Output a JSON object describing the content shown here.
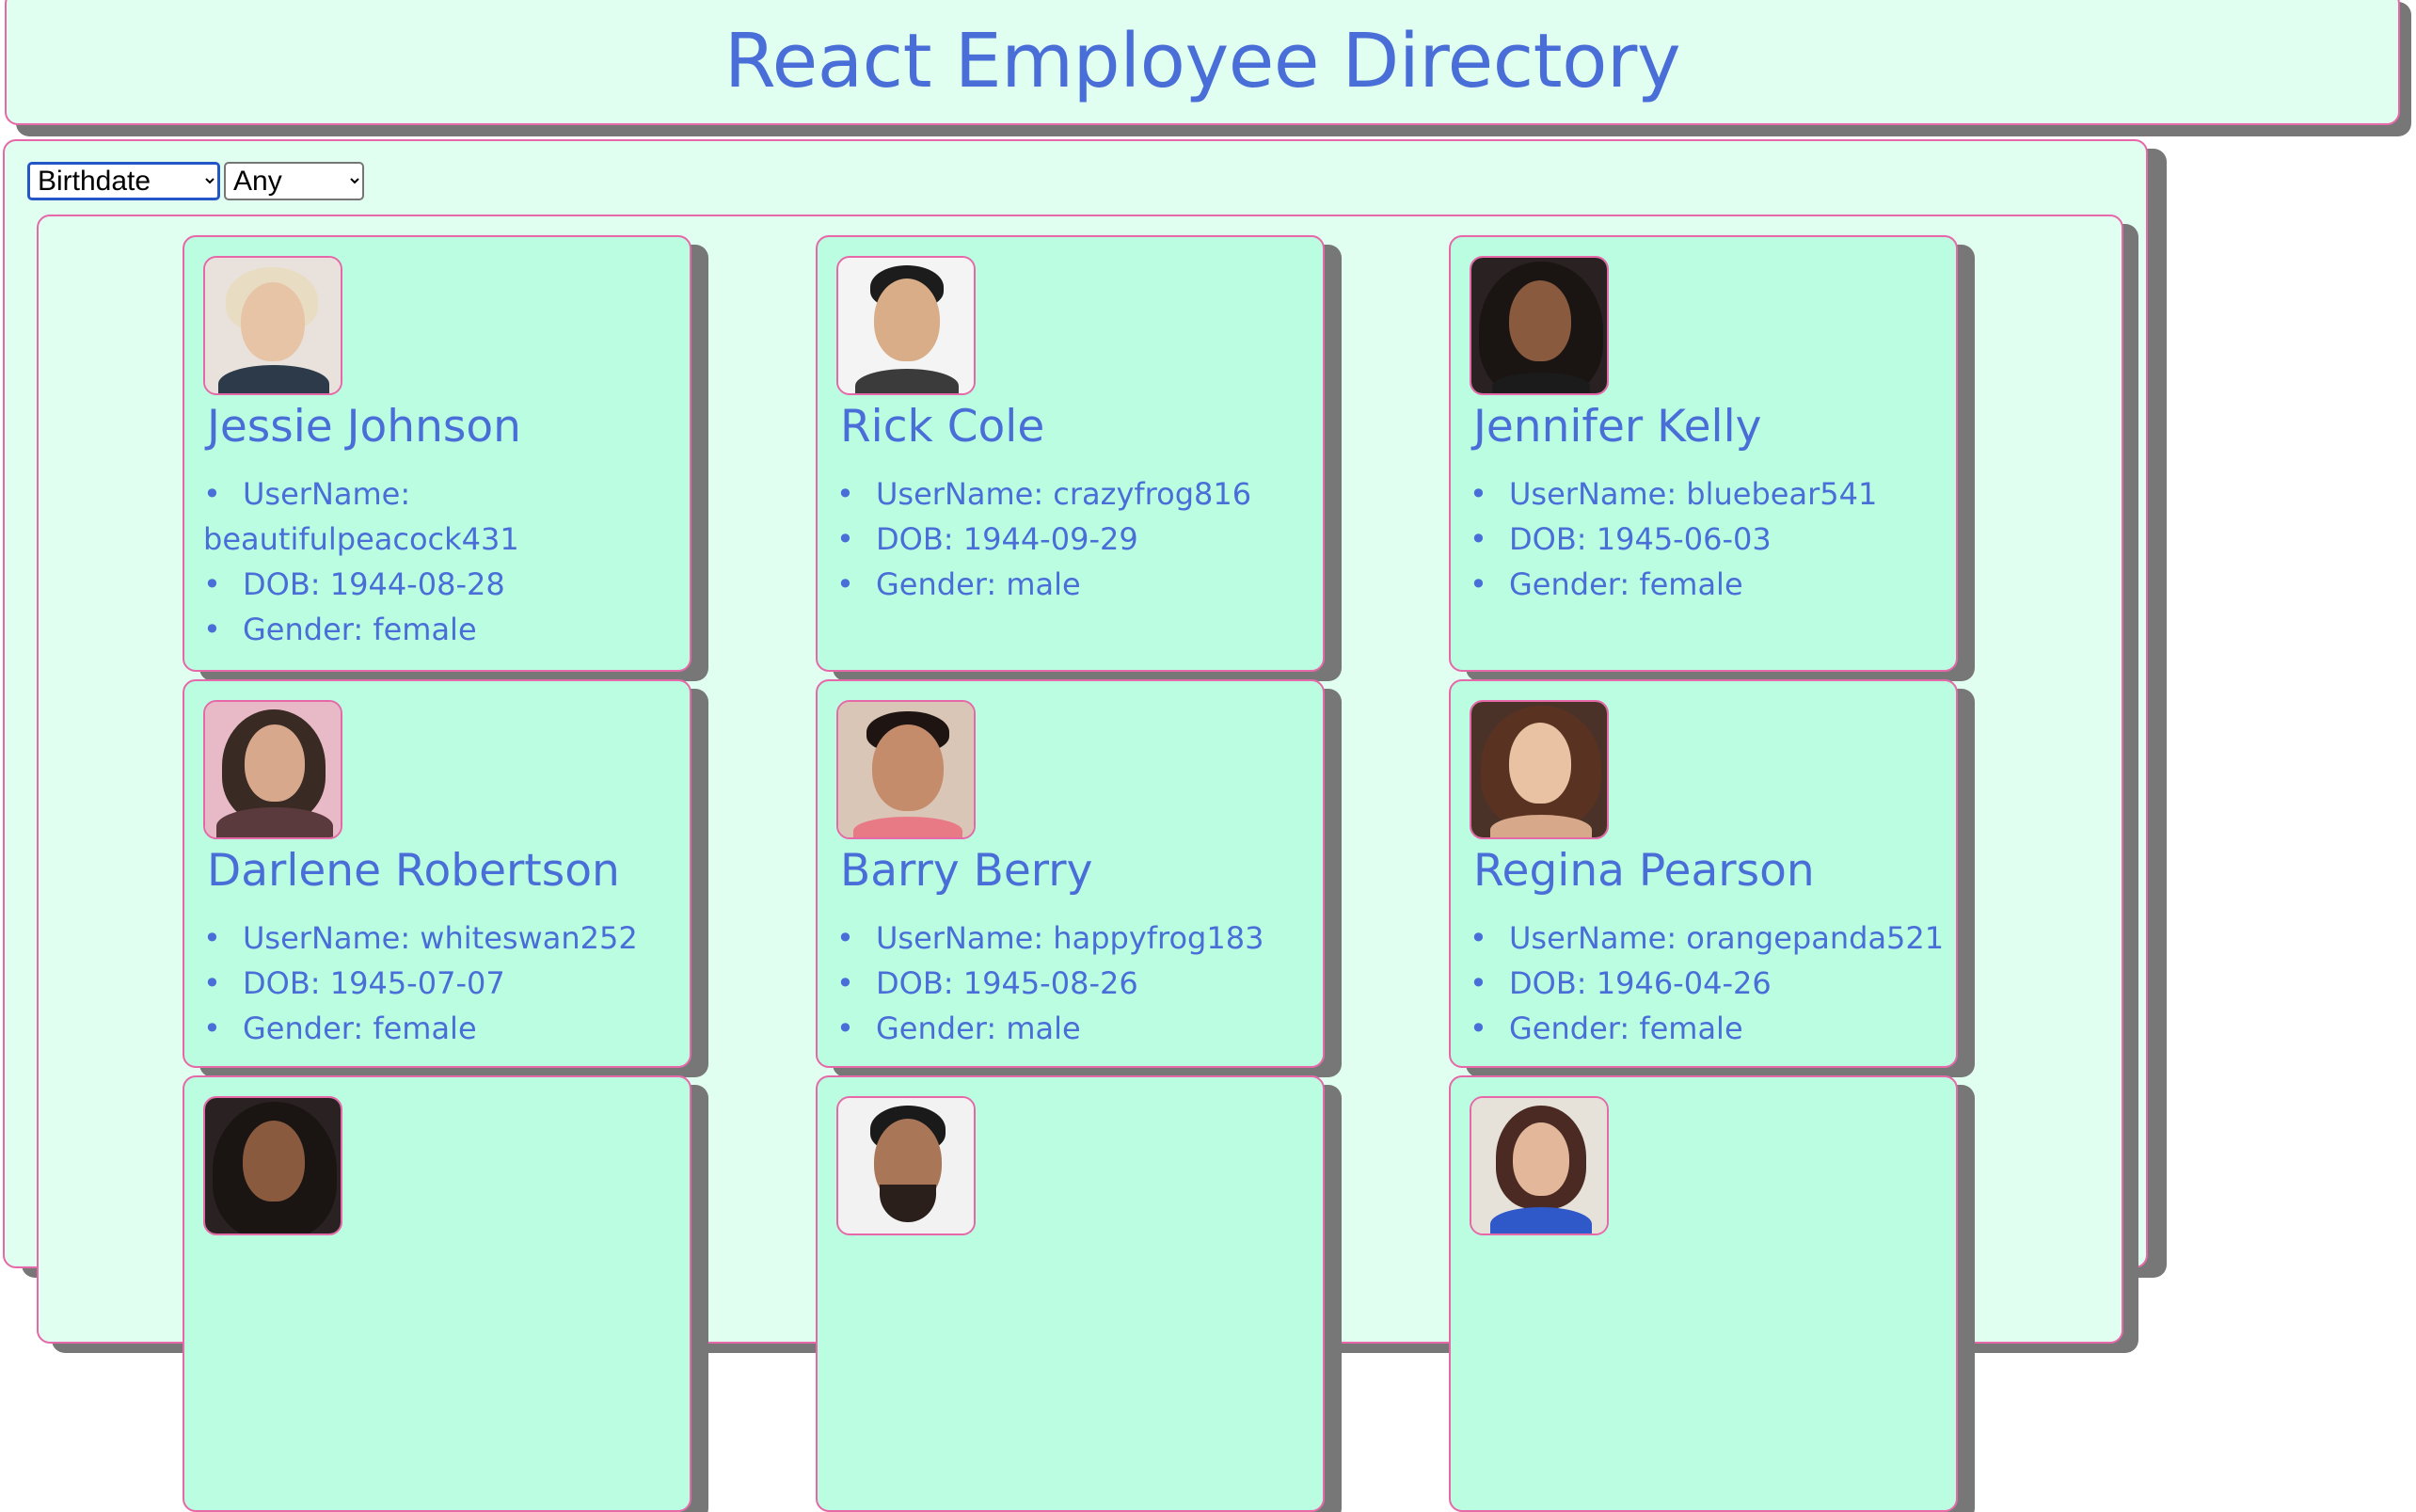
{
  "header": {
    "title": "React Employee Directory"
  },
  "filters": {
    "field": {
      "selected": "Birthdate"
    },
    "value": {
      "selected": "Any"
    }
  },
  "employees": [
    {
      "name": "Jessie Johnson",
      "username_label": "UserName:",
      "username": "beautifulpeacock431",
      "dob": "DOB: 1944-08-28",
      "gender": "Gender: female"
    },
    {
      "name": "Rick Cole",
      "username": "UserName: crazyfrog816",
      "dob": "DOB: 1944-09-29",
      "gender": "Gender: male"
    },
    {
      "name": "Jennifer Kelly",
      "username": "UserName: bluebear541",
      "dob": "DOB: 1945-06-03",
      "gender": "Gender: female"
    },
    {
      "name": "Darlene Robertson",
      "username": "UserName: whiteswan252",
      "dob": "DOB: 1945-07-07",
      "gender": "Gender: female"
    },
    {
      "name": "Barry Berry",
      "username": "UserName: happyfrog183",
      "dob": "DOB: 1945-08-26",
      "gender": "Gender: male"
    },
    {
      "name": "Regina Pearson",
      "username": "UserName: orangepanda521",
      "dob": "DOB: 1946-04-26",
      "gender": "Gender: female"
    }
  ],
  "colors": {
    "accent_text": "#4a6ed8",
    "card_background": "#bbfde0",
    "panel_background": "#e0fff0",
    "border": "#e668a8",
    "shadow": "#777777"
  }
}
